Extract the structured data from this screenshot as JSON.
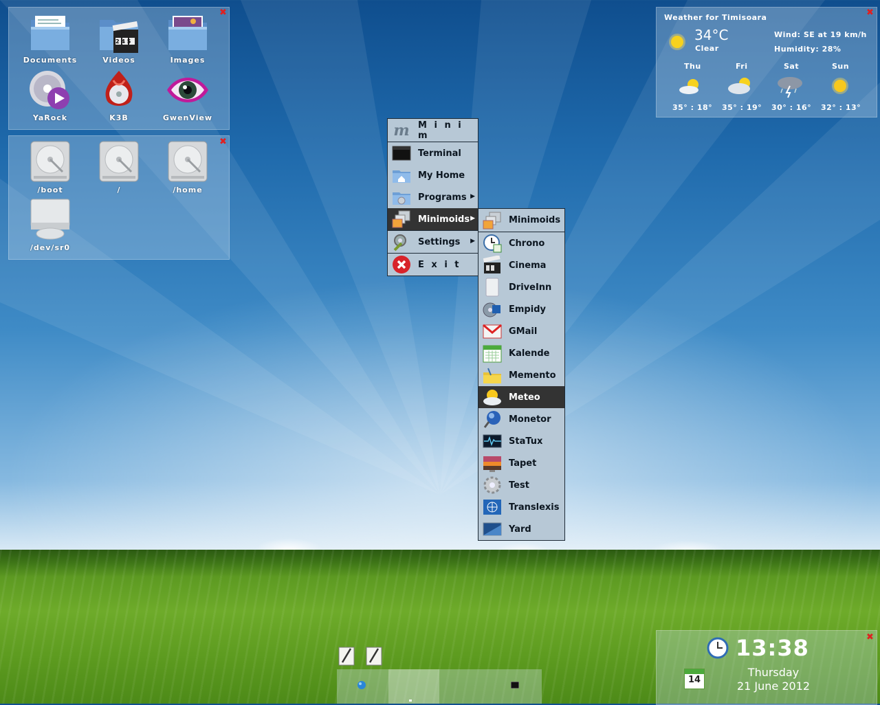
{
  "desktop": {
    "apps": [
      {
        "label": "Documents",
        "icon": "documents-folder-icon"
      },
      {
        "label": "Videos",
        "icon": "videos-folder-icon"
      },
      {
        "label": "Images",
        "icon": "images-folder-icon"
      },
      {
        "label": "YaRock",
        "icon": "yarock-icon"
      },
      {
        "label": "K3B",
        "icon": "k3b-icon"
      },
      {
        "label": "GwenView",
        "icon": "gwenview-icon"
      }
    ],
    "drives": [
      {
        "label": "/boot",
        "icon": "hard-disk-icon"
      },
      {
        "label": "/",
        "icon": "hard-disk-icon"
      },
      {
        "label": "/home",
        "icon": "hard-disk-icon"
      },
      {
        "label": "/dev/sr0",
        "icon": "optical-drive-icon"
      }
    ],
    "clapper_digits": "2 4 5"
  },
  "weather": {
    "title": "Weather for Timisoara",
    "temp": "34°C",
    "condition": "Clear",
    "wind": "Wind: SE at 19 km/h",
    "humidity": "Humidity: 28%",
    "forecast": [
      {
        "day": "Thu",
        "range": "35° : 18°",
        "icon": "partly-cloudy-icon"
      },
      {
        "day": "Fri",
        "range": "35° : 19°",
        "icon": "cloudy-sun-icon"
      },
      {
        "day": "Sat",
        "range": "30° : 16°",
        "icon": "thunderstorm-icon"
      },
      {
        "day": "Sun",
        "range": "32° : 13°",
        "icon": "sun-icon"
      }
    ]
  },
  "main_menu": {
    "header": "M i n i m",
    "header_logo": "m",
    "items": [
      {
        "label": "Terminal",
        "icon": "terminal-icon"
      },
      {
        "label": "My Home",
        "icon": "home-folder-icon"
      },
      {
        "label": "Programs",
        "icon": "programs-folder-icon",
        "submenu": true
      },
      {
        "label": "Minimoids",
        "icon": "minimoids-icon",
        "submenu": true,
        "highlighted": true
      },
      {
        "label": "Settings",
        "icon": "settings-icon",
        "submenu": true
      },
      {
        "label": "E x i t",
        "icon": "exit-icon"
      }
    ]
  },
  "sub_menu": {
    "header": "Minimoids",
    "items": [
      {
        "label": "Chrono",
        "icon": "chrono-icon"
      },
      {
        "label": "Cinema",
        "icon": "cinema-icon"
      },
      {
        "label": "DriveInn",
        "icon": "driveinn-icon"
      },
      {
        "label": "Empidy",
        "icon": "empidy-icon"
      },
      {
        "label": "GMail",
        "icon": "gmail-icon"
      },
      {
        "label": "Kalende",
        "icon": "calendar-icon"
      },
      {
        "label": "Memento",
        "icon": "memento-icon"
      },
      {
        "label": "Meteo",
        "icon": "meteo-icon",
        "highlighted": true
      },
      {
        "label": "Monetor",
        "icon": "monetor-icon"
      },
      {
        "label": "StaTux",
        "icon": "statux-icon"
      },
      {
        "label": "Tapet",
        "icon": "tapet-icon"
      },
      {
        "label": "Test",
        "icon": "test-icon"
      },
      {
        "label": "Translexis",
        "icon": "translexis-icon"
      },
      {
        "label": "Yard",
        "icon": "yard-icon"
      }
    ]
  },
  "clock": {
    "time": "13:38",
    "day": "Thursday",
    "date": "21 June 2012",
    "calendar_day": "14"
  },
  "close_glyph": "✖",
  "colors": {
    "highlight": "#333333",
    "menu_bg": "#b7c8d6",
    "close": "#e02020"
  }
}
